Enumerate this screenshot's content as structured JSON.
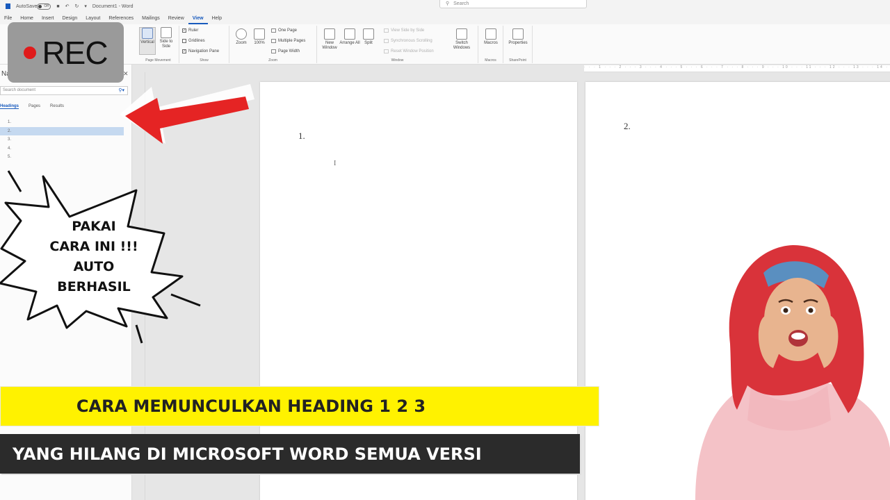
{
  "titlebar": {
    "autosave_label": "AutoSave",
    "autosave_state": "Off",
    "doc_title": "Document1 - Word",
    "search_placeholder": "Search"
  },
  "menu": {
    "tabs": [
      "File",
      "Home",
      "Insert",
      "Design",
      "Layout",
      "References",
      "Mailings",
      "Review",
      "View",
      "Help"
    ],
    "active": "View"
  },
  "ribbon": {
    "views": {
      "vertical": "Vertical",
      "side_to_side": "Side to Side",
      "group_label": "Page Movement"
    },
    "show": {
      "ruler": "Ruler",
      "gridlines": "Gridlines",
      "navigation_pane": "Navigation Pane",
      "group_label": "Show"
    },
    "zoom": {
      "zoom": "Zoom",
      "hundred": "100%",
      "one_page": "One Page",
      "multiple_pages": "Multiple Pages",
      "page_width": "Page Width",
      "group_label": "Zoom"
    },
    "window": {
      "new_window": "New Window",
      "arrange_all": "Arrange All",
      "split": "Split",
      "view_side_by_side": "View Side by Side",
      "synchronous_scrolling": "Synchronous Scrolling",
      "reset_window_position": "Reset Window Position",
      "switch_windows": "Switch Windows",
      "group_label": "Window"
    },
    "macros": {
      "macros": "Macros",
      "group_label": "Macros"
    },
    "sharepoint": {
      "properties": "Properties",
      "group_label": "SharePoint"
    }
  },
  "navpane": {
    "title": "Na",
    "search_placeholder": "Search document",
    "tabs": [
      "Headings",
      "Pages",
      "Results"
    ],
    "active_tab": "Headings",
    "headings": [
      "1.",
      "2.",
      "3.",
      "4.",
      "5."
    ],
    "selected_index": 1
  },
  "document": {
    "page1_number": "1.",
    "page2_number": "2.",
    "cursor": "I"
  },
  "overlay": {
    "rec_label": "REC",
    "burst_lines": [
      "PAKAI",
      "CARA INI !!!",
      "AUTO",
      "BERHASIL"
    ],
    "banner_title": "CARA MEMUNCULKAN HEADING 1 2 3",
    "banner_subtitle": "YANG HILANG DI MICROSOFT WORD SEMUA VERSI"
  },
  "colors": {
    "accent": "#185abd",
    "banner_yellow": "#fff200",
    "banner_dark": "#2b2b2b",
    "arrow_red": "#e52424",
    "rec_dot": "#e01b1b"
  }
}
